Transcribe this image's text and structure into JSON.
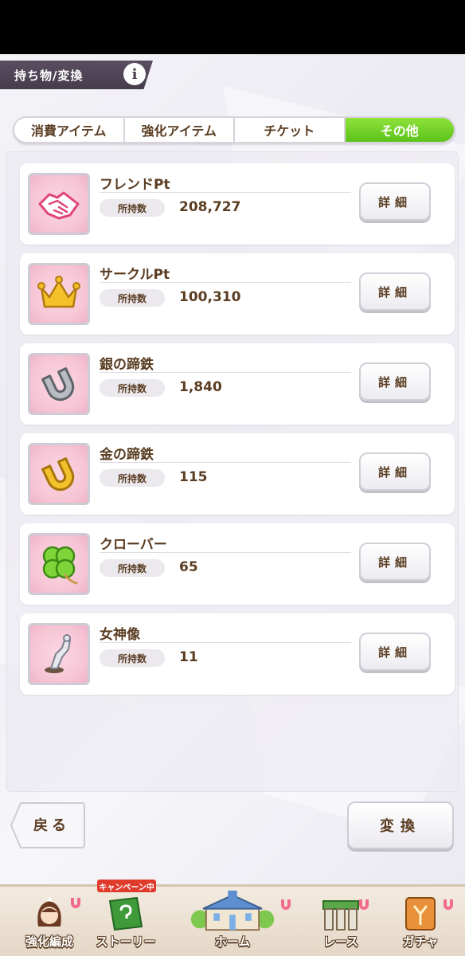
{
  "header": {
    "title": "持ち物/変換",
    "info_glyph": "i"
  },
  "tabs": [
    {
      "label": "消費アイテム",
      "active": false
    },
    {
      "label": "強化アイテム",
      "active": false
    },
    {
      "label": "チケット",
      "active": false
    },
    {
      "label": "その他",
      "active": true
    }
  ],
  "items": [
    {
      "name": "フレンドPt",
      "count_label": "所持数",
      "count": "208,727",
      "detail_label": "詳細",
      "icon": "handshake-icon"
    },
    {
      "name": "サークルPt",
      "count_label": "所持数",
      "count": "100,310",
      "detail_label": "詳細",
      "icon": "crown-icon"
    },
    {
      "name": "銀の蹄鉄",
      "count_label": "所持数",
      "count": "1,840",
      "detail_label": "詳細",
      "icon": "silver-horseshoe-icon"
    },
    {
      "name": "金の蹄鉄",
      "count_label": "所持数",
      "count": "115",
      "detail_label": "詳細",
      "icon": "gold-horseshoe-icon"
    },
    {
      "name": "クローバー",
      "count_label": "所持数",
      "count": "65",
      "detail_label": "詳細",
      "icon": "clover-icon"
    },
    {
      "name": "女神像",
      "count_label": "所持数",
      "count": "11",
      "detail_label": "詳細",
      "icon": "goddess-statue-icon"
    }
  ],
  "footer": {
    "back_label": "戻る",
    "convert_label": "変換"
  },
  "nav": {
    "campaign_badge": "キャンペーン中",
    "items": [
      {
        "label": "強化編成",
        "icon": "character-icon"
      },
      {
        "label": "ストーリー",
        "icon": "story-book-icon"
      },
      {
        "label": "ホーム",
        "icon": "home-building-icon"
      },
      {
        "label": "レース",
        "icon": "race-gate-icon"
      },
      {
        "label": "ガチャ",
        "icon": "gacha-icon"
      }
    ]
  },
  "colors": {
    "accent_green": "#6ccf24",
    "text_brown": "#5a3d22",
    "title_bar": "#4f4456"
  }
}
